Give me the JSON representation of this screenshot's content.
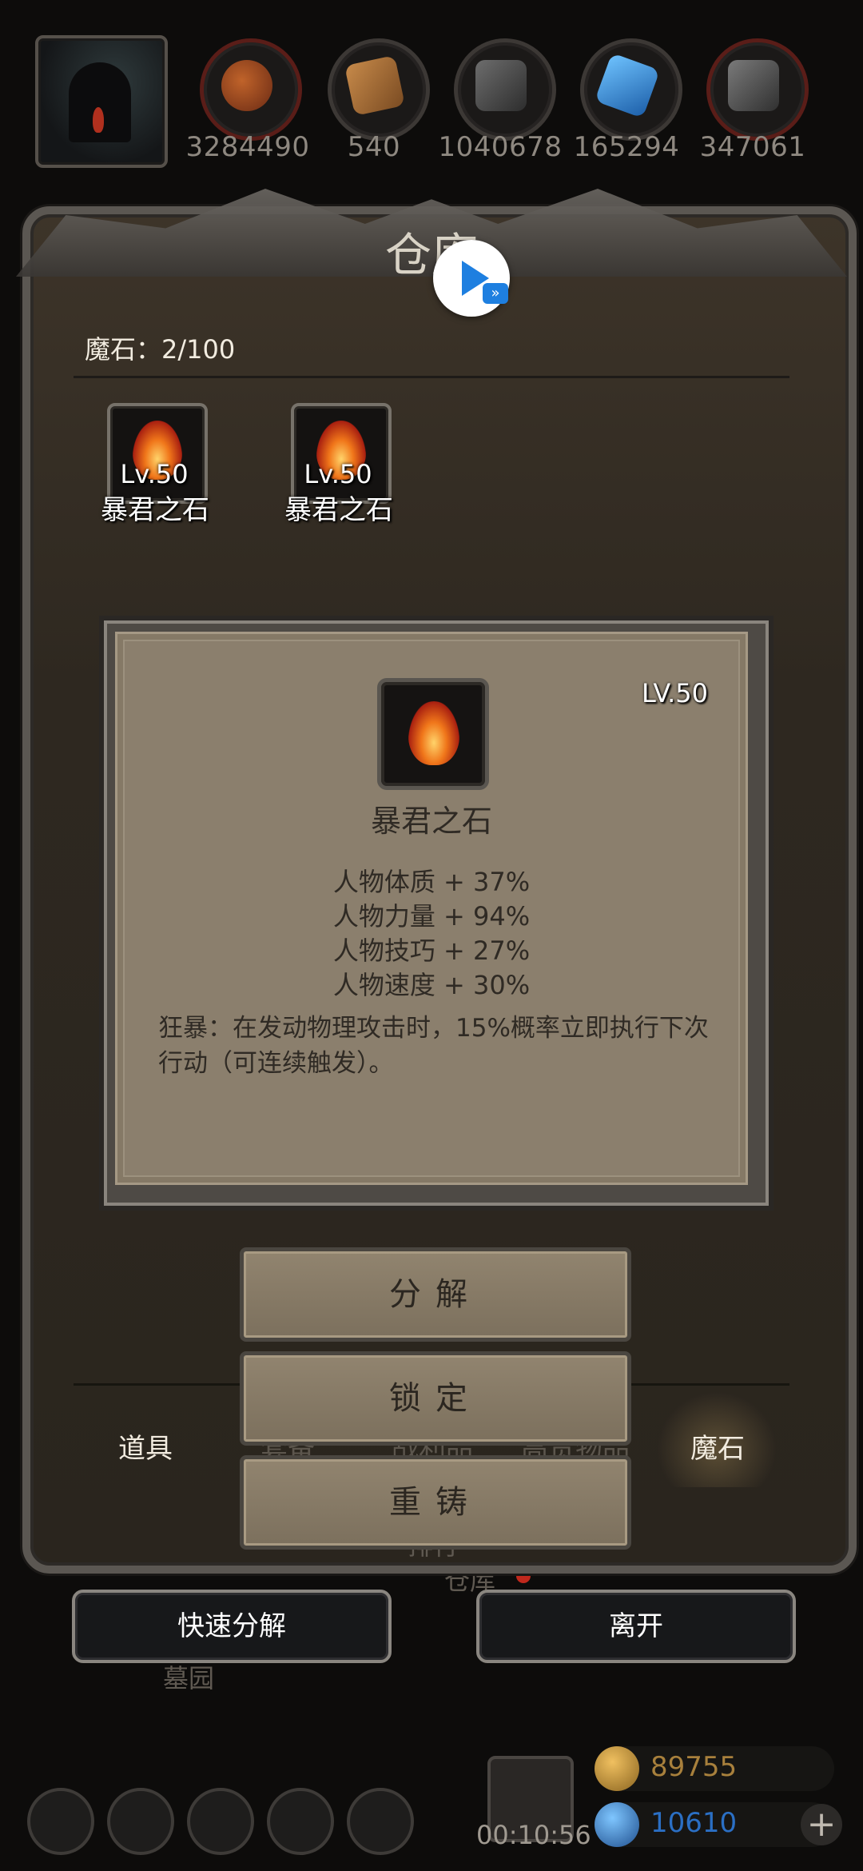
{
  "resources": [
    {
      "icon": "meat-icon",
      "value": "3284490"
    },
    {
      "icon": "wood-icon",
      "value": "540"
    },
    {
      "icon": "iron-icon",
      "value": "1040678"
    },
    {
      "icon": "crystal-icon",
      "value": "165294"
    },
    {
      "icon": "ore-icon",
      "value": "347061"
    }
  ],
  "panel": {
    "title": "仓库",
    "count_label": "魔石：2/100"
  },
  "slots": [
    {
      "level": "Lv.50",
      "name": "暴君之石"
    },
    {
      "level": "Lv.50",
      "name": "暴君之石"
    }
  ],
  "detail": {
    "level": "LV.50",
    "name": "暴君之石",
    "stats": [
      "人物体质 + 37%",
      "人物力量 + 94%",
      "人物技巧 + 27%",
      "人物速度 + 30%"
    ],
    "description": "狂暴：在发动物理攻击时，15%概率立即执行下次行动（可连续触发）。"
  },
  "actions": {
    "decompose": "分解",
    "lock": "锁定",
    "reforge": "重铸"
  },
  "tabs": [
    {
      "label": "道具"
    },
    {
      "label": "套备"
    },
    {
      "label": "战利品"
    },
    {
      "label": "高贵物品"
    },
    {
      "label": "魔石"
    }
  ],
  "background_labels": {
    "warehouse": "仓库",
    "rank": "排行",
    "graveyard": "墓园"
  },
  "buttons": {
    "quick_decompose": "快速分解",
    "leave": "离开"
  },
  "hud": {
    "timer": "00:10:56",
    "gold": "89755",
    "gems": "10610",
    "plus": "+"
  },
  "colors": {
    "accent_blue": "#1e7fe0",
    "gold": "#a8803c",
    "gem": "#2b6fc4"
  }
}
